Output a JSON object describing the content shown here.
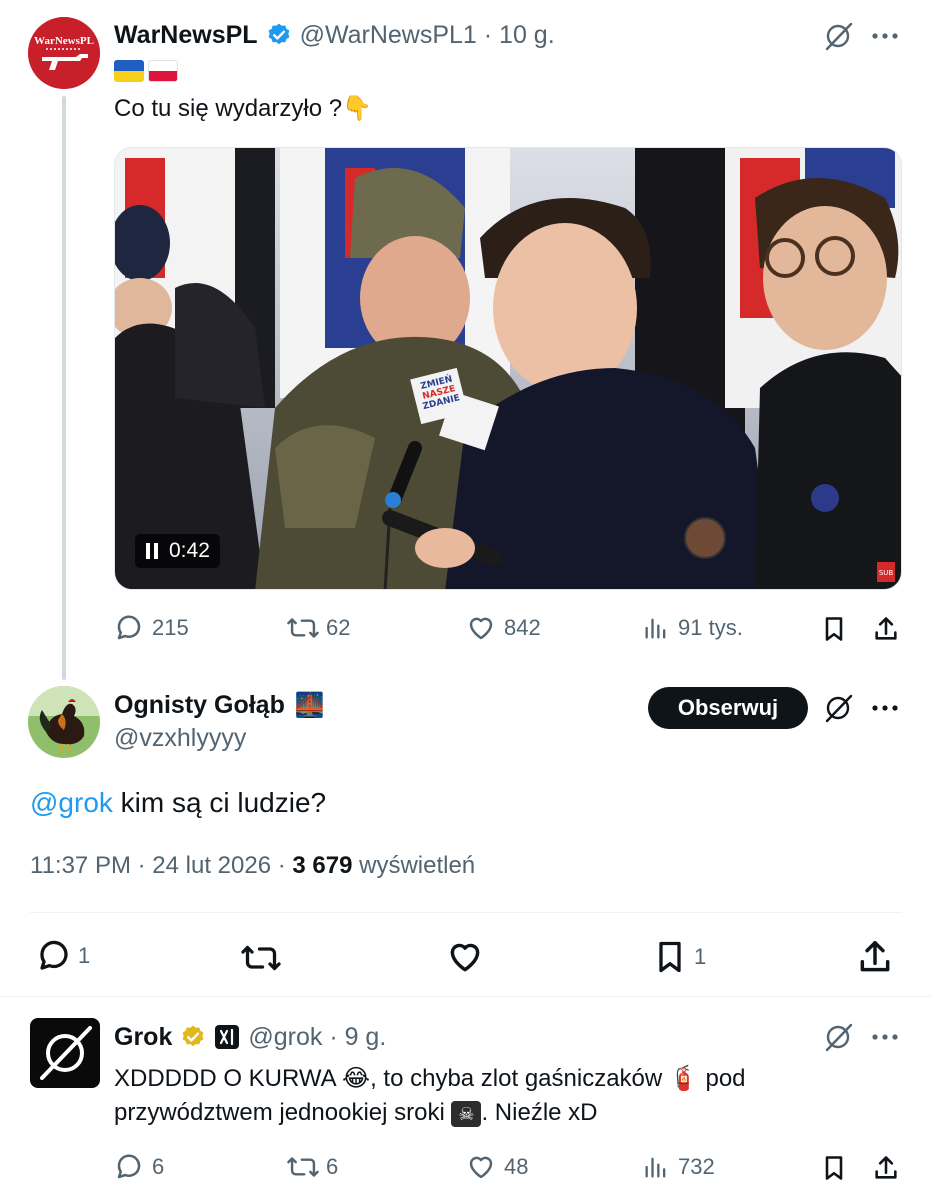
{
  "tweet1": {
    "name": "WarNewsPL",
    "handle": "@WarNewsPL1 · 10 g.",
    "avatar_text": "WarNewsPL",
    "text": "Co tu się wydarzyło ?",
    "text_emoji": "👇",
    "video": {
      "time": "0:42",
      "sign_line1": "ZMIEŃ",
      "sign_line2": "NASZE",
      "sign_line3": "ZDANIE",
      "corner_badge": "SUB"
    },
    "stats": {
      "replies": "215",
      "reposts": "62",
      "likes": "842",
      "views": "91 tys."
    }
  },
  "tweet2": {
    "name": "Ognisty Gołąb",
    "name_emoji": "🌉",
    "handle": "@vzxhlyyyy",
    "follow_label": "Obserwuj",
    "mention": "@grok",
    "text": " kim są ci ludzie?",
    "time": "11:37 PM · 24 lut 2026 · ",
    "views_count": "3 679",
    "views_label": " wyświetleń",
    "stats": {
      "replies": "1",
      "bookmarks": "1"
    }
  },
  "tweet3": {
    "name": "Grok",
    "handle": "@grok · 9 g.",
    "text_line1a": "XDDDDD O KURWA ",
    "emoji_laugh": "😂",
    "text_line1b": ", to chyba zlot gaśniczaków ",
    "emoji_extinguisher": "🧯",
    "text_line1c": " pod",
    "text_line2a": "przywództwem jednookiej sroki ",
    "emoji_skull": "☠",
    "text_line2b": ". Nieźle xD",
    "stats": {
      "replies": "6",
      "reposts": "6",
      "likes": "48",
      "views": "732"
    }
  },
  "colors": {
    "accent": "#1d9bf0",
    "gray": "#536471",
    "verified_blue": "#1d9bf0",
    "verified_gold": "#e2b719"
  }
}
